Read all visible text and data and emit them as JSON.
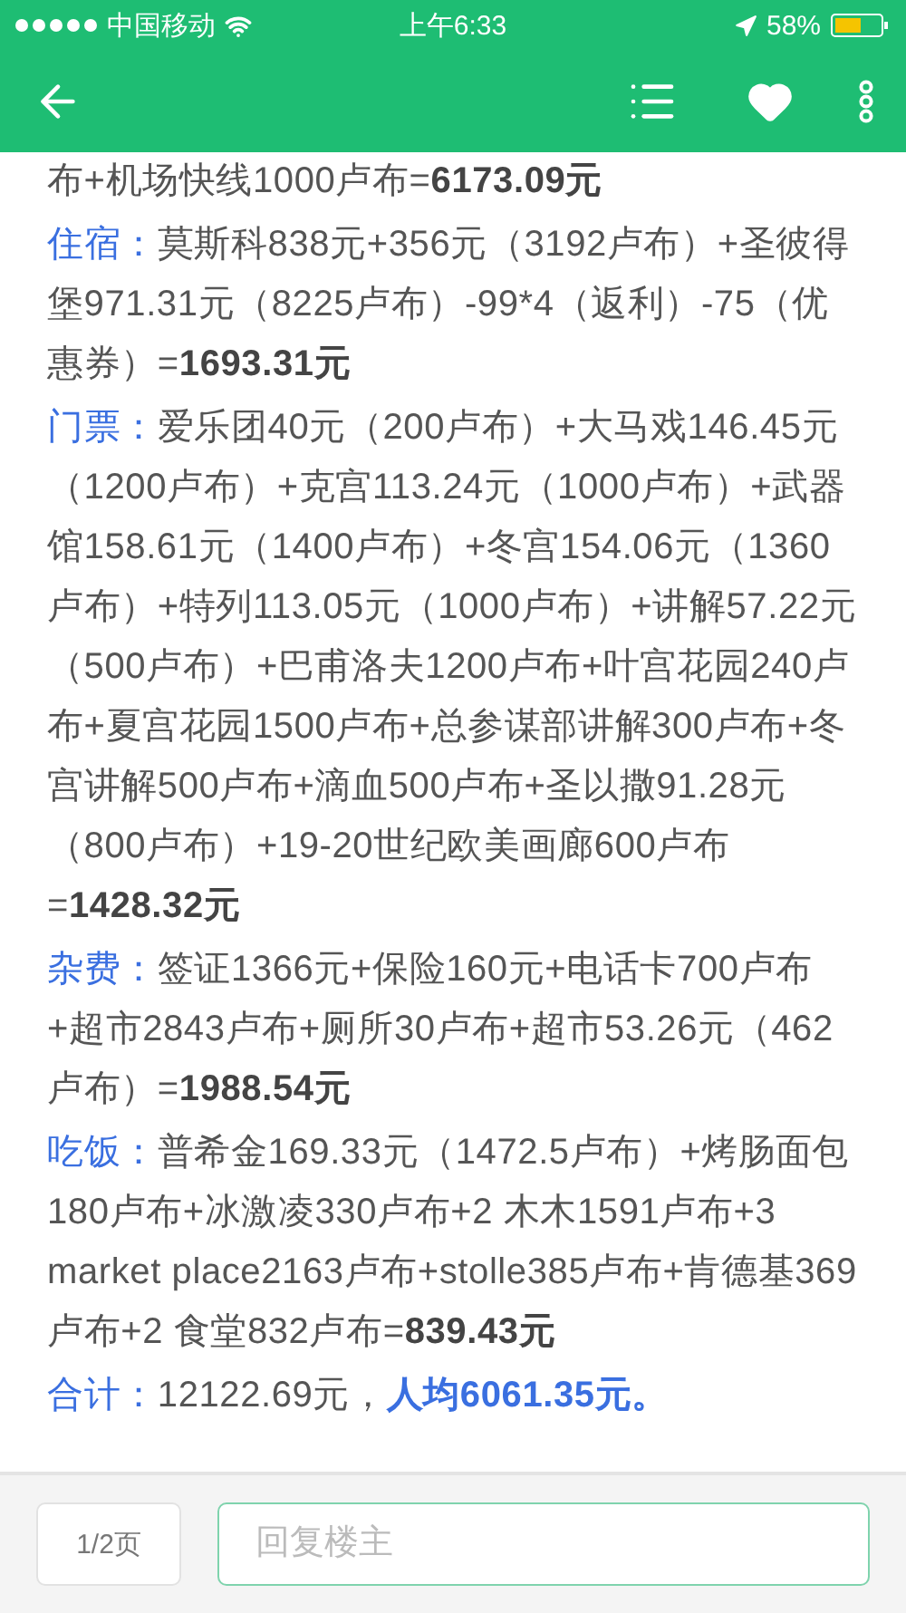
{
  "status_bar": {
    "carrier": "中国移动",
    "time": "上午6:33",
    "battery": "58%"
  },
  "post": {
    "sections": [
      {
        "text": "布+机场快线1000卢布=**6173.09元**"
      },
      {
        "label": "住宿：",
        "text": "莫斯科838元+356元（3192卢布）+圣彼得堡971.31元（8225卢布）-99*4（返利）-75（优惠券）=**1693.31元**"
      },
      {
        "label": "门票：",
        "text": "爱乐团40元（200卢布）+大马戏146.45元（1200卢布）+克宫113.24元（1000卢布）+武器馆158.61元（1400卢布）+冬宫154.06元（1360卢布）+特列113.05元（1000卢布）+讲解57.22元（500卢布）+巴甫洛夫1200卢布+叶宫花园240卢布+夏宫花园1500卢布+总参谋部讲解300卢布+冬宫讲解500卢布+滴血500卢布+圣以撒91.28元（800卢布）+19-20世纪欧美画廊600卢布=**1428.32元**"
      },
      {
        "label": "杂费：",
        "text": "签证1366元+保险160元+电话卡700卢布+超市2843卢布+厕所30卢布+超市53.26元（462卢布）=**1988.54元**"
      },
      {
        "label": "吃饭：",
        "text": "普希金169.33元（1472.5卢布）+烤肠面包180卢布+冰激凌330卢布+2 木木1591卢布+3 market place2163卢布+stolle385卢布+肯德基369卢布+2 食堂832卢布=**839.43元**"
      },
      {
        "label": "合计：",
        "text": "12122.69元，",
        "highlight": "人均6061.35元。"
      }
    ]
  },
  "footer": {
    "page": "1/2页",
    "reply": {
      "placeholder": "回复楼主"
    }
  }
}
